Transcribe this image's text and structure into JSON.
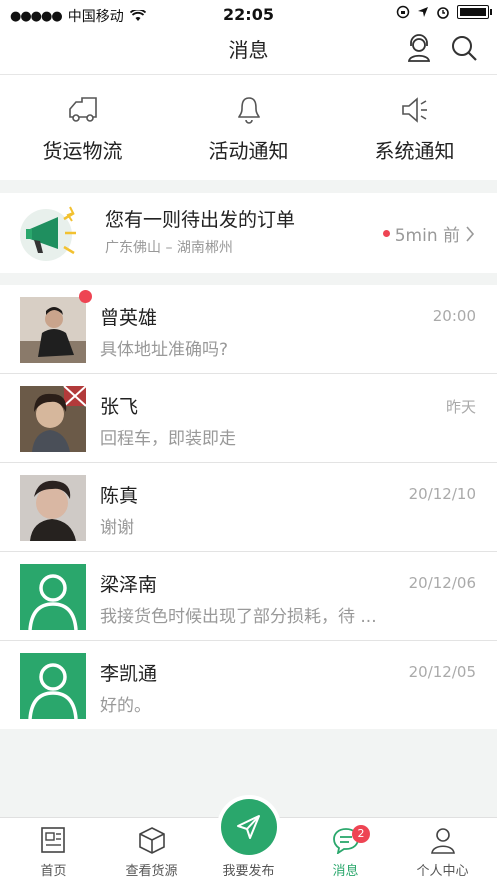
{
  "status_bar": {
    "carrier": "中国移动",
    "time": "22:05"
  },
  "nav": {
    "title": "消息"
  },
  "categories": [
    {
      "label": "货运物流",
      "icon": "truck-icon"
    },
    {
      "label": "活动通知",
      "icon": "bell-icon"
    },
    {
      "label": "系统通知",
      "icon": "speaker-icon"
    }
  ],
  "notice": {
    "title": "您有一则待出发的订单",
    "route": "广东佛山 – 湖南郴州",
    "time": "5min 前"
  },
  "messages": [
    {
      "name": "曾英雄",
      "preview": "具体地址准确吗?",
      "time": "20:00",
      "unread": true
    },
    {
      "name": "张飞",
      "preview": "回程车，即装即走",
      "time": "昨天",
      "unread": false
    },
    {
      "name": "陈真",
      "preview": "谢谢",
      "time": "20/12/10",
      "unread": false
    },
    {
      "name": "梁泽南",
      "preview": "我接货色时候出现了部分损耗，待 ...",
      "time": "20/12/06",
      "unread": false
    },
    {
      "name": "李凯通",
      "preview": "好的。",
      "time": "20/12/05",
      "unread": false
    }
  ],
  "tabs": [
    {
      "label": "首页"
    },
    {
      "label": "查看货源"
    },
    {
      "label": "我要发布"
    },
    {
      "label": "消息",
      "badge": "2",
      "active": true
    },
    {
      "label": "个人中心"
    }
  ],
  "colors": {
    "accent": "#2aa76c",
    "badge": "#ee4453"
  }
}
